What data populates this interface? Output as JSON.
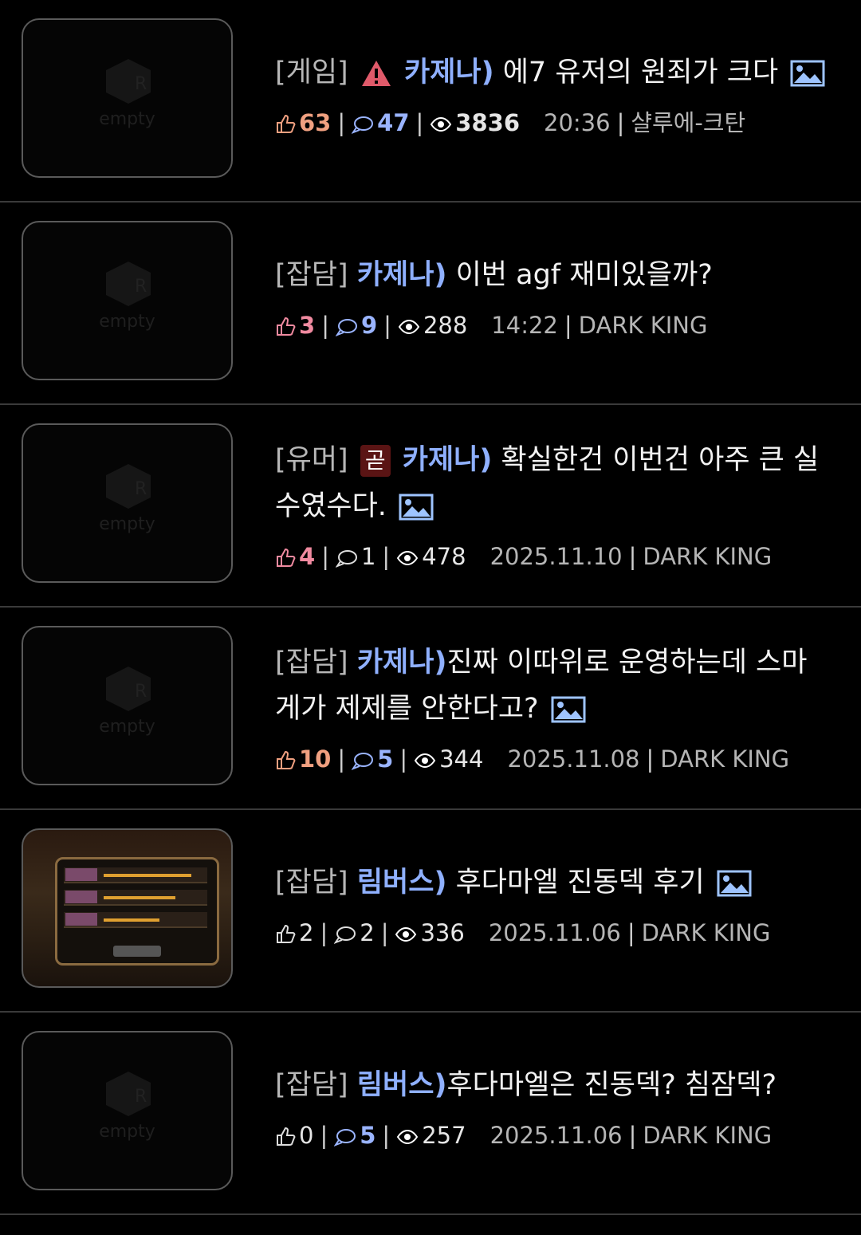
{
  "posts": [
    {
      "category": "[게임]",
      "tag": "카제나)",
      "title": " 에7 유저의 원죄가 크다",
      "warn": true,
      "hot": "",
      "has_image": true,
      "likes": "63",
      "comments": "47",
      "views": "3836",
      "time": "20:36",
      "author": "샬루에-크탄",
      "thumb": "empty"
    },
    {
      "category": "[잡담]",
      "tag": "카제나)",
      "title": " 이번 agf 재미있을까?",
      "warn": false,
      "hot": "",
      "has_image": false,
      "likes": "3",
      "comments": "9",
      "views": "288",
      "time": "14:22",
      "author": "DARK KING",
      "thumb": "empty"
    },
    {
      "category": "[유머]",
      "tag": "카제나)",
      "title": " 확실한건 이번건 아주 큰 실수였수다.",
      "warn": false,
      "hot": "곧",
      "has_image": true,
      "likes": "4",
      "comments": "1",
      "views": "478",
      "time": "2025.11.10",
      "author": "DARK KING",
      "thumb": "empty"
    },
    {
      "category": "[잡담]",
      "tag": "카제나)",
      "title": "진짜 이따위로 운영하는데 스마게가 제제를 안한다고?",
      "warn": false,
      "hot": "",
      "has_image": true,
      "likes": "10",
      "comments": "5",
      "views": "344",
      "time": "2025.11.08",
      "author": "DARK KING",
      "thumb": "empty"
    },
    {
      "category": "[잡담]",
      "tag": "림버스)",
      "title": " 후다마엘 진동덱 후기",
      "warn": false,
      "hot": "",
      "has_image": true,
      "likes": "2",
      "comments": "2",
      "views": "336",
      "time": "2025.11.06",
      "author": "DARK KING",
      "thumb": "screenshot"
    },
    {
      "category": "[잡담]",
      "tag": "림버스)",
      "title": "후다마엘은 진동덱? 침잠덱?",
      "warn": false,
      "hot": "",
      "has_image": false,
      "likes": "0",
      "comments": "5",
      "views": "257",
      "time": "2025.11.06",
      "author": "DARK KING",
      "thumb": "empty"
    }
  ],
  "placeholder_text": "empty",
  "separator": "|",
  "colors": {
    "background": "#000000",
    "tag": "#8fb0ff",
    "category": "#b7b7b7",
    "like": "#f0a0a0",
    "comment": "#9ab4ff",
    "warn": "#e05a6a",
    "hot_badge": "#5a1414"
  }
}
